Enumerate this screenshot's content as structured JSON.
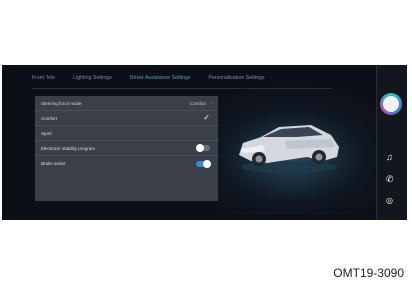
{
  "tabs": [
    {
      "label": "Front Tele"
    },
    {
      "label": "Lighting Settings"
    },
    {
      "label": "Driver Assistance Settings"
    },
    {
      "label": "Personalisation Settings"
    }
  ],
  "settings": [
    {
      "label": "Steering force mode",
      "value": "Comfort"
    },
    {
      "label": "Comfort"
    },
    {
      "label": "Sport"
    },
    {
      "label": "Electronic stability program"
    },
    {
      "label": "Brake assist"
    }
  ],
  "toggles": {
    "electronic_stability_program": "off",
    "brake_assist": "on"
  },
  "caption": "OMT19-3090",
  "colors": {
    "active_tab": "#5fa0c8",
    "toggle_on": "#2f8fd0",
    "panel": "#3b3f4a",
    "background": "#0d0f16"
  },
  "icons": [
    "chevron-right-icon",
    "checkmark-icon",
    "car-icon",
    "music-icon",
    "phone-icon",
    "navigation-icon"
  ]
}
